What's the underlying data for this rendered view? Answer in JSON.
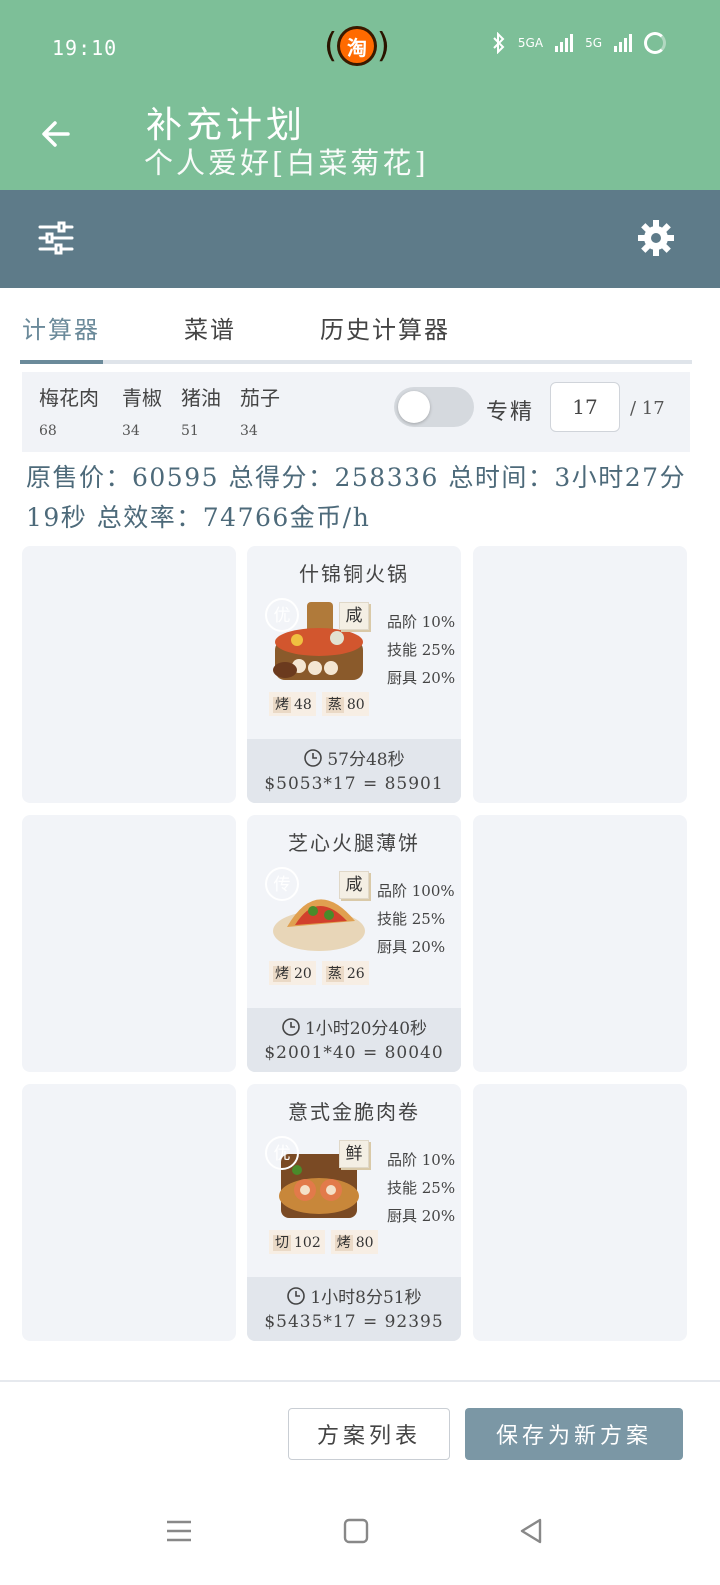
{
  "status": {
    "time": "19:10",
    "app_badge": "淘",
    "sig1": "5GA",
    "sig2": "5G"
  },
  "header": {
    "title": "补充计划",
    "subtitle": "个人爱好[白菜菊花]"
  },
  "tabs": [
    {
      "label": "计算器"
    },
    {
      "label": "菜谱"
    },
    {
      "label": "历史计算器"
    }
  ],
  "ingredients": [
    {
      "name": "梅花肉",
      "count": "68"
    },
    {
      "name": "青椒",
      "count": "34"
    },
    {
      "name": "猪油",
      "count": "51"
    },
    {
      "name": "茄子",
      "count": "34"
    }
  ],
  "specialize": {
    "label": "专精",
    "value": "17",
    "max": "/ 17"
  },
  "summary": "原售价：60595 总得分：258336 总时间：3小时27分19秒 总效率：74766金币/h",
  "dishes": [
    {
      "name": "什锦铜火锅",
      "rarity": "优",
      "rarity_color": "#6f9a2e",
      "flavor": "咸",
      "grade": "品阶 10%",
      "skill": "技能 25%",
      "tool": "厨具 20%",
      "skills": [
        {
          "k": "烤",
          "v": "48"
        },
        {
          "k": "蒸",
          "v": "80"
        }
      ],
      "time": "57分48秒",
      "price": "$5053*17 = 85901"
    },
    {
      "name": "芝心火腿薄饼",
      "rarity": "传",
      "rarity_color": "#8a3f7e",
      "flavor": "咸",
      "grade": "品阶 100%",
      "skill": "技能 25%",
      "tool": "厨具 20%",
      "skills": [
        {
          "k": "烤",
          "v": "20"
        },
        {
          "k": "蒸",
          "v": "26"
        }
      ],
      "time": "1小时20分40秒",
      "price": "$2001*40 = 80040"
    },
    {
      "name": "意式金脆肉卷",
      "rarity": "优",
      "rarity_color": "#6f9a2e",
      "flavor": "鲜",
      "grade": "品阶 10%",
      "skill": "技能 25%",
      "tool": "厨具 20%",
      "skills": [
        {
          "k": "切",
          "v": "102"
        },
        {
          "k": "烤",
          "v": "80"
        }
      ],
      "time": "1小时8分51秒",
      "price": "$5435*17 = 92395"
    }
  ],
  "buttons": {
    "list": "方案列表",
    "save": "保存为新方案"
  },
  "icons": {
    "back": "arrow-left-icon",
    "filter": "sliders-icon",
    "settings": "gear-icon",
    "clock": "clock-icon"
  }
}
